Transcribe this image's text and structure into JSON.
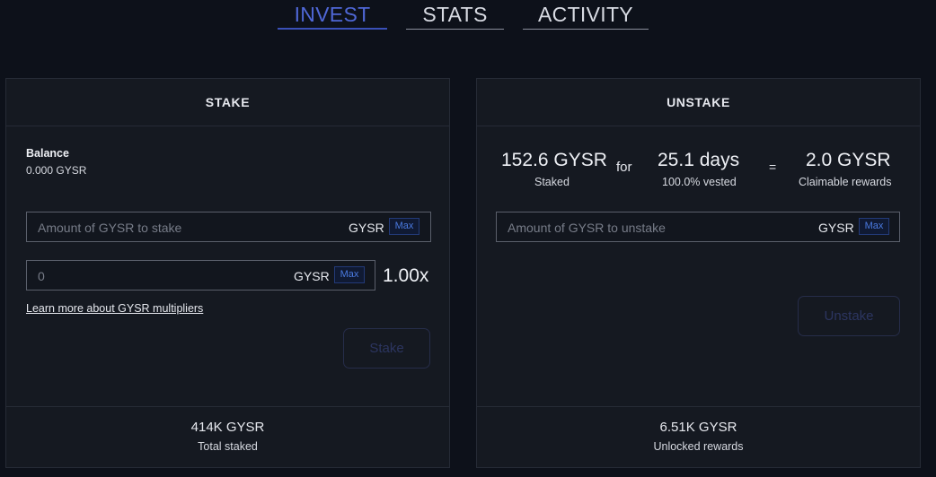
{
  "tabs": [
    {
      "label": "INVEST"
    },
    {
      "label": "STATS"
    },
    {
      "label": "ACTIVITY"
    }
  ],
  "stake": {
    "title": "STAKE",
    "balance_label": "Balance",
    "balance_value": "0.000 GYSR",
    "amount_placeholder": "Amount of GYSR to stake",
    "amount_unit": "GYSR",
    "max_label": "Max",
    "multiplier_placeholder": "0",
    "multiplier_unit": "GYSR",
    "multiplier_max_label": "Max",
    "multiplier_value": "1.00x",
    "learn_more": "Learn more about GYSR multipliers",
    "button_label": "Stake",
    "footer_value": "414K GYSR",
    "footer_label": "Total staked"
  },
  "unstake": {
    "title": "UNSTAKE",
    "staked_value": "152.6 GYSR",
    "staked_label": "Staked",
    "for_text": "for",
    "days_value": "25.1 days",
    "days_label": "100.0% vested",
    "equals_text": "=",
    "claim_value": "2.0 GYSR",
    "claim_label": "Claimable rewards",
    "amount_placeholder": "Amount of GYSR to unstake",
    "amount_unit": "GYSR",
    "max_label": "Max",
    "button_label": "Unstake",
    "footer_value": "6.51K GYSR",
    "footer_label": "Unlocked rewards"
  }
}
